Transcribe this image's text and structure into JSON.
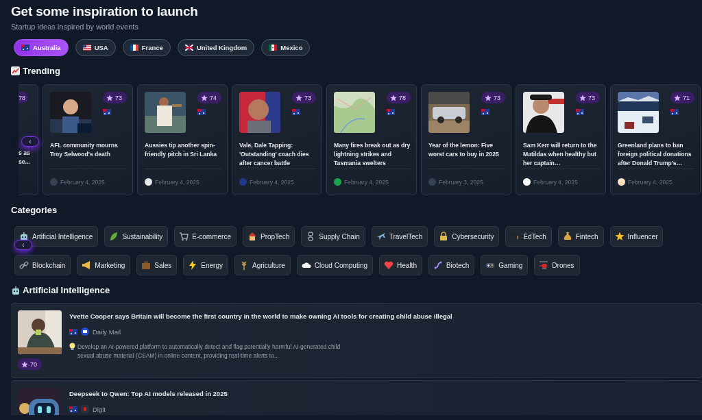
{
  "header": {
    "title": "Get some **inspiration** to launch",
    "subtitle": "Startup ideas inspired by world events"
  },
  "countries": [
    {
      "label": "Australia",
      "selected": true
    },
    {
      "label": "USA",
      "selected": false
    },
    {
      "label": "France",
      "selected": false
    },
    {
      "label": "United Kingdom",
      "selected": false
    },
    {
      "label": "Mexico",
      "selected": false
    }
  ],
  "trending": {
    "heading": "Trending",
    "prev_button": "‹",
    "cards": [
      {
        "kind": "partial",
        "score": "78",
        "title": [
          "s as",
          "se..."
        ]
      },
      {
        "kind": "full",
        "score": "73",
        "title": [
          "AFL community mourns Troy Selwood's death"
        ],
        "date": "February 4, 2025"
      },
      {
        "kind": "full",
        "score": "74",
        "title": [
          "Aussies tip another spin-friendly pitch in Sri Lanka"
        ],
        "date": "February 4, 2025"
      },
      {
        "kind": "full",
        "score": "73",
        "title": [
          "Vale, Dale Tapping: 'Outstanding' coach dies after cancer battle"
        ],
        "date": "February 4, 2025"
      },
      {
        "kind": "full",
        "score": "78",
        "title": [
          "Many fires break out as dry lightning strikes and Tasmania swelters"
        ],
        "date": "February 4, 2025"
      },
      {
        "kind": "full",
        "score": "73",
        "title": [
          "Year of the lemon: Five worst cars to buy in 2025"
        ],
        "date": "February 3, 2025"
      },
      {
        "kind": "full",
        "score": "73",
        "title": [
          "Sam Kerr will return to the Matildas when healthy but her captain…"
        ],
        "date": "February 4, 2025"
      },
      {
        "kind": "full",
        "score": "71",
        "title": [
          "Greenland plans to ban foreign political donations after Donald Trump's…"
        ],
        "date": "February 4, 2025"
      }
    ]
  },
  "categories": {
    "heading": "Categories",
    "prev_button": "‹",
    "rows": [
      {
        "chips": [
          "Artificial Intelligence",
          "Sustainability",
          "E-commerce",
          "PropTech",
          "Supply Chain",
          "TravelTech",
          "Cybersecurity",
          "EdTech",
          "Fintech",
          "Influencer"
        ]
      },
      {
        "chips": [
          "Blockchain",
          "Marketing",
          "Sales",
          "Energy",
          "Agriculture",
          "Cloud Computing",
          "Health",
          "Biotech",
          "Gaming",
          "Drones"
        ]
      }
    ]
  },
  "section": {
    "heading": "Artificial Intelligence",
    "articles": [
      {
        "title": "Yvette Cooper says Britain will become the first country in the world to make owning AI tools for creating child abuse illegal",
        "source": "Daily Mail",
        "idea": "Develop an AI-powered platform to automatically detect and flag potentially harmful AI-generated child sexual abuse material (CSAM) in online content, providing real-time alerts to...",
        "score": "70"
      },
      {
        "title": "Deepseek to Qwen: Top AI models released in 2025",
        "source": "Digit"
      }
    ]
  }
}
